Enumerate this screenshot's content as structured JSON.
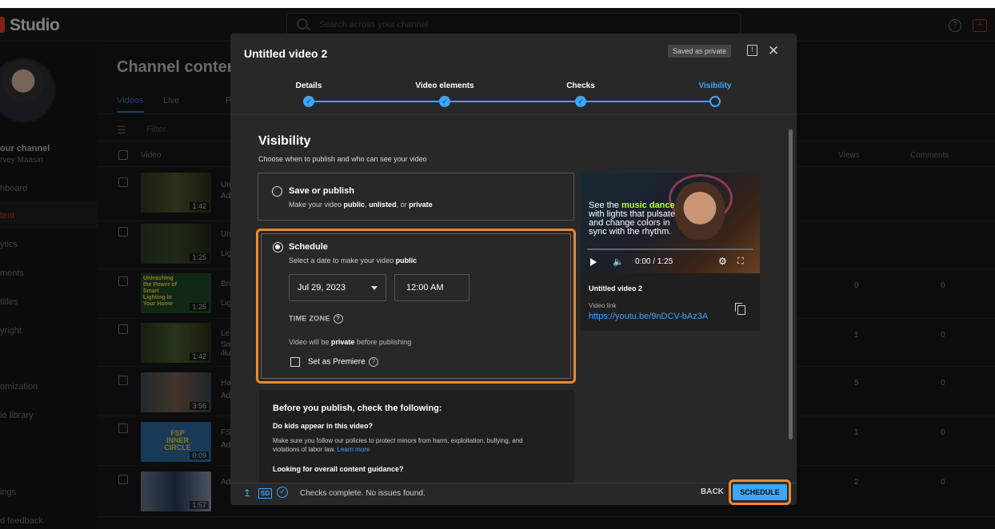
{
  "topbar": {
    "app_name": "Studio",
    "search_placeholder": "Search across your channel"
  },
  "sidebar": {
    "channel_title": "our channel",
    "channel_owner": "rvey Maasin",
    "items": [
      "hboard",
      "tent",
      "ytics",
      "ments",
      "titles",
      "yright",
      "omization",
      "io library",
      "ings",
      "d feedback"
    ]
  },
  "main": {
    "title": "Channel content",
    "tabs": [
      "Videos",
      "Live",
      "P"
    ],
    "filter_label": "Filter",
    "columns": {
      "video": "Video",
      "views": "Views",
      "comments": "Comments"
    },
    "rows": [
      {
        "duration": "1:42",
        "title": "Un",
        "meta": "Ad",
        "views": "",
        "comments": ""
      },
      {
        "duration": "1:25",
        "title": "Un",
        "meta": "Lig",
        "views": "",
        "comments": ""
      },
      {
        "duration": "1:25",
        "title": "Bri",
        "meta": "Lig",
        "views": "0",
        "comments": "0",
        "thumb_text": "Unleashing the Power of Smart Lighting in Your Home"
      },
      {
        "duration": "1:42",
        "title": "Le",
        "meta": "Sm illu",
        "views": "1",
        "comments": "0"
      },
      {
        "duration": "3:56",
        "title": "Ha",
        "meta": "Ad",
        "views": "5",
        "comments": "0"
      },
      {
        "duration": "0:09",
        "title": "FS",
        "meta": "Ad",
        "views": "1",
        "comments": "0",
        "thumb_text": "FSP INNER CIRCLE"
      },
      {
        "duration": "1:57",
        "title": "Ad",
        "meta": "",
        "views": "2",
        "comments": "0"
      }
    ]
  },
  "modal": {
    "title": "Untitled video 2",
    "saved_badge": "Saved as private",
    "steps": [
      {
        "label": "Details",
        "done": true
      },
      {
        "label": "Video elements",
        "done": true
      },
      {
        "label": "Checks",
        "done": true
      },
      {
        "label": "Visibility",
        "done": false,
        "current": true
      }
    ],
    "visibility_heading": "Visibility",
    "visibility_sub": "Choose when to publish and who can see your video",
    "save_publish": {
      "title": "Save or publish",
      "desc_prefix": "Make your video ",
      "public": "public",
      "sep1": ", ",
      "unlisted": "unlisted",
      "sep2": ", or ",
      "private": "private"
    },
    "schedule": {
      "title": "Schedule",
      "desc_prefix": "Select a date to make your video ",
      "desc_bold": "public",
      "date": "Jul 29, 2023",
      "time": "12:00 AM",
      "timezone_label": "TIME ZONE",
      "note_prefix": "Video will be ",
      "note_bold": "private",
      "note_suffix": " before publishing",
      "premiere_label": "Set as Premiere",
      "selected": true
    },
    "before_publish": {
      "heading": "Before you publish, check the following:",
      "q1": "Do kids appear in this video?",
      "q1_text": "Make sure you follow our policies to protect minors from harm, exploitation, bullying, and violations of labor law.",
      "learn_more": "Learn more",
      "q2": "Looking for overall content guidance?"
    },
    "preview": {
      "overlay_prefix": "See the ",
      "overlay_green": "music dance",
      "overlay_suffix": " with lights that pulsate and change colors in sync with the rhythm.",
      "time": "0:00 / 1:25",
      "video_title": "Untitled video 2",
      "link_label": "Video link",
      "link": "https://youtu.be/9nDCV-bAz3A"
    },
    "footer": {
      "sd": "SD",
      "status": "Checks complete. No issues found.",
      "back": "BACK",
      "schedule": "SCHEDULE"
    }
  },
  "colors": {
    "accent": "#3ea6ff",
    "highlight": "#e98a2f",
    "brand_red": "#e8402c"
  }
}
